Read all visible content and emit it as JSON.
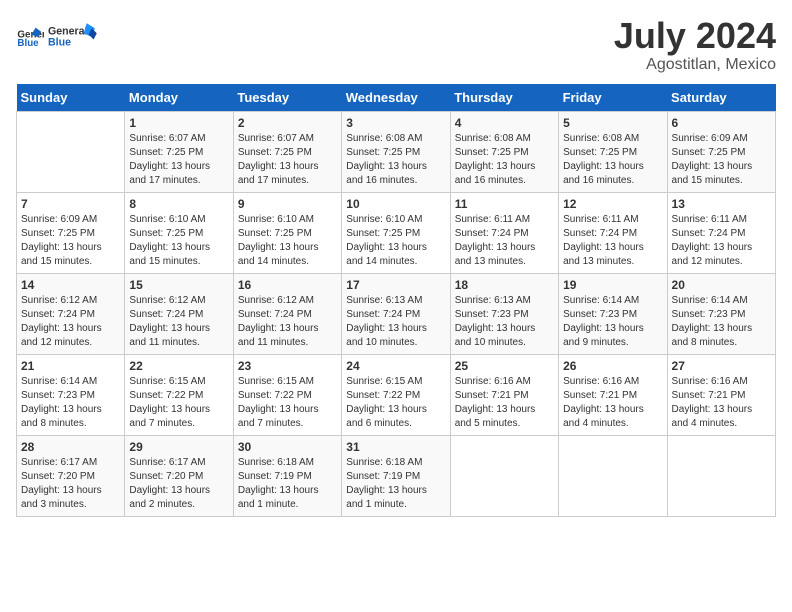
{
  "header": {
    "logo_general": "General",
    "logo_blue": "Blue",
    "month_title": "July 2024",
    "location": "Agostitlan, Mexico"
  },
  "days_of_week": [
    "Sunday",
    "Monday",
    "Tuesday",
    "Wednesday",
    "Thursday",
    "Friday",
    "Saturday"
  ],
  "weeks": [
    [
      {
        "day": "",
        "sunrise": "",
        "sunset": "",
        "daylight": ""
      },
      {
        "day": "1",
        "sunrise": "6:07 AM",
        "sunset": "7:25 PM",
        "daylight": "13 hours and 17 minutes."
      },
      {
        "day": "2",
        "sunrise": "6:07 AM",
        "sunset": "7:25 PM",
        "daylight": "13 hours and 17 minutes."
      },
      {
        "day": "3",
        "sunrise": "6:08 AM",
        "sunset": "7:25 PM",
        "daylight": "13 hours and 16 minutes."
      },
      {
        "day": "4",
        "sunrise": "6:08 AM",
        "sunset": "7:25 PM",
        "daylight": "13 hours and 16 minutes."
      },
      {
        "day": "5",
        "sunrise": "6:08 AM",
        "sunset": "7:25 PM",
        "daylight": "13 hours and 16 minutes."
      },
      {
        "day": "6",
        "sunrise": "6:09 AM",
        "sunset": "7:25 PM",
        "daylight": "13 hours and 15 minutes."
      }
    ],
    [
      {
        "day": "7",
        "sunrise": "6:09 AM",
        "sunset": "7:25 PM",
        "daylight": "13 hours and 15 minutes."
      },
      {
        "day": "8",
        "sunrise": "6:10 AM",
        "sunset": "7:25 PM",
        "daylight": "13 hours and 15 minutes."
      },
      {
        "day": "9",
        "sunrise": "6:10 AM",
        "sunset": "7:25 PM",
        "daylight": "13 hours and 14 minutes."
      },
      {
        "day": "10",
        "sunrise": "6:10 AM",
        "sunset": "7:25 PM",
        "daylight": "13 hours and 14 minutes."
      },
      {
        "day": "11",
        "sunrise": "6:11 AM",
        "sunset": "7:24 PM",
        "daylight": "13 hours and 13 minutes."
      },
      {
        "day": "12",
        "sunrise": "6:11 AM",
        "sunset": "7:24 PM",
        "daylight": "13 hours and 13 minutes."
      },
      {
        "day": "13",
        "sunrise": "6:11 AM",
        "sunset": "7:24 PM",
        "daylight": "13 hours and 12 minutes."
      }
    ],
    [
      {
        "day": "14",
        "sunrise": "6:12 AM",
        "sunset": "7:24 PM",
        "daylight": "13 hours and 12 minutes."
      },
      {
        "day": "15",
        "sunrise": "6:12 AM",
        "sunset": "7:24 PM",
        "daylight": "13 hours and 11 minutes."
      },
      {
        "day": "16",
        "sunrise": "6:12 AM",
        "sunset": "7:24 PM",
        "daylight": "13 hours and 11 minutes."
      },
      {
        "day": "17",
        "sunrise": "6:13 AM",
        "sunset": "7:24 PM",
        "daylight": "13 hours and 10 minutes."
      },
      {
        "day": "18",
        "sunrise": "6:13 AM",
        "sunset": "7:23 PM",
        "daylight": "13 hours and 10 minutes."
      },
      {
        "day": "19",
        "sunrise": "6:14 AM",
        "sunset": "7:23 PM",
        "daylight": "13 hours and 9 minutes."
      },
      {
        "day": "20",
        "sunrise": "6:14 AM",
        "sunset": "7:23 PM",
        "daylight": "13 hours and 8 minutes."
      }
    ],
    [
      {
        "day": "21",
        "sunrise": "6:14 AM",
        "sunset": "7:23 PM",
        "daylight": "13 hours and 8 minutes."
      },
      {
        "day": "22",
        "sunrise": "6:15 AM",
        "sunset": "7:22 PM",
        "daylight": "13 hours and 7 minutes."
      },
      {
        "day": "23",
        "sunrise": "6:15 AM",
        "sunset": "7:22 PM",
        "daylight": "13 hours and 7 minutes."
      },
      {
        "day": "24",
        "sunrise": "6:15 AM",
        "sunset": "7:22 PM",
        "daylight": "13 hours and 6 minutes."
      },
      {
        "day": "25",
        "sunrise": "6:16 AM",
        "sunset": "7:21 PM",
        "daylight": "13 hours and 5 minutes."
      },
      {
        "day": "26",
        "sunrise": "6:16 AM",
        "sunset": "7:21 PM",
        "daylight": "13 hours and 4 minutes."
      },
      {
        "day": "27",
        "sunrise": "6:16 AM",
        "sunset": "7:21 PM",
        "daylight": "13 hours and 4 minutes."
      }
    ],
    [
      {
        "day": "28",
        "sunrise": "6:17 AM",
        "sunset": "7:20 PM",
        "daylight": "13 hours and 3 minutes."
      },
      {
        "day": "29",
        "sunrise": "6:17 AM",
        "sunset": "7:20 PM",
        "daylight": "13 hours and 2 minutes."
      },
      {
        "day": "30",
        "sunrise": "6:18 AM",
        "sunset": "7:19 PM",
        "daylight": "13 hours and 1 minute."
      },
      {
        "day": "31",
        "sunrise": "6:18 AM",
        "sunset": "7:19 PM",
        "daylight": "13 hours and 1 minute."
      },
      {
        "day": "",
        "sunrise": "",
        "sunset": "",
        "daylight": ""
      },
      {
        "day": "",
        "sunrise": "",
        "sunset": "",
        "daylight": ""
      },
      {
        "day": "",
        "sunrise": "",
        "sunset": "",
        "daylight": ""
      }
    ]
  ],
  "labels": {
    "sunrise_prefix": "Sunrise: ",
    "sunset_prefix": "Sunset: ",
    "daylight_prefix": "Daylight: "
  }
}
